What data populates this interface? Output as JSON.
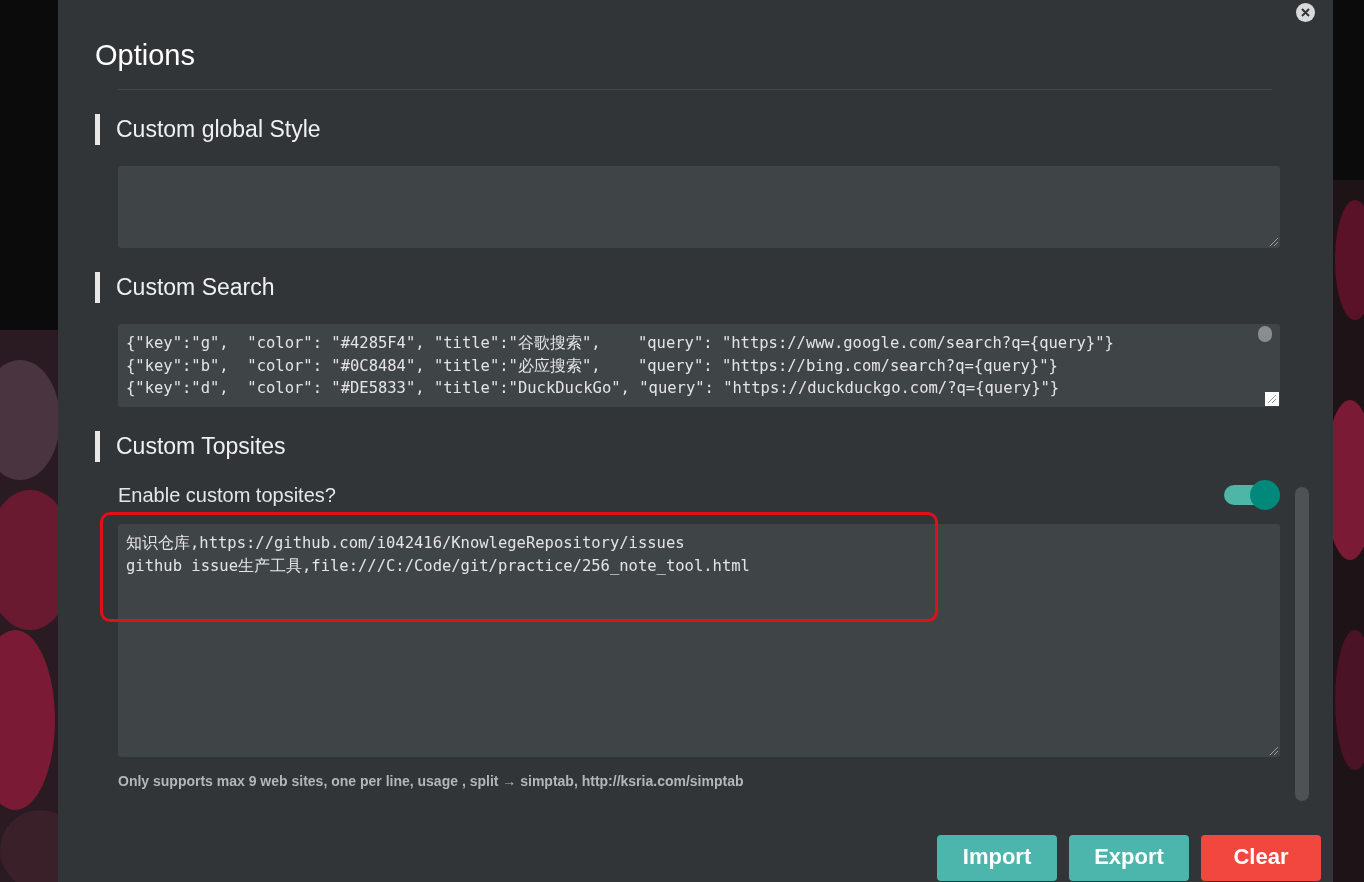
{
  "dialog": {
    "title": "Options"
  },
  "sections": [
    {
      "kind": "style",
      "heading": "Custom global Style"
    },
    {
      "kind": "search",
      "heading": "Custom Search",
      "lines": [
        "{\"key\":\"g\",  \"color\": \"#4285F4\", \"title\":\"谷歌搜索\",    \"query\": \"https://www.google.com/search?q={query}\"}",
        "{\"key\":\"b\",  \"color\": \"#0C8484\", \"title\":\"必应搜索\",    \"query\": \"https://bing.com/search?q={query}\"}",
        "{\"key\":\"d\",  \"color\": \"#DE5833\", \"title\":\"DuckDuckGo\", \"query\": \"https://duckduckgo.com/?q={query}\"}"
      ]
    },
    {
      "kind": "topsites",
      "heading": "Custom Topsites",
      "toggle": {
        "label": "Enable custom topsites?",
        "on": true
      },
      "lines": [
        "知识仓库,https://github.com/i042416/KnowlegeRepository/issues",
        "github issue生产工具,file:///C:/Code/git/practice/256_note_tool.html"
      ],
      "highlighted": true,
      "hint": "Only supports max 9 web sites, one per line, usage , split → simptab, http://ksria.com/simptab"
    }
  ],
  "buttons": [
    {
      "label": "Import",
      "kind": "neutral"
    },
    {
      "label": "Export",
      "kind": "neutral"
    },
    {
      "label": "Clear",
      "kind": "danger"
    }
  ]
}
